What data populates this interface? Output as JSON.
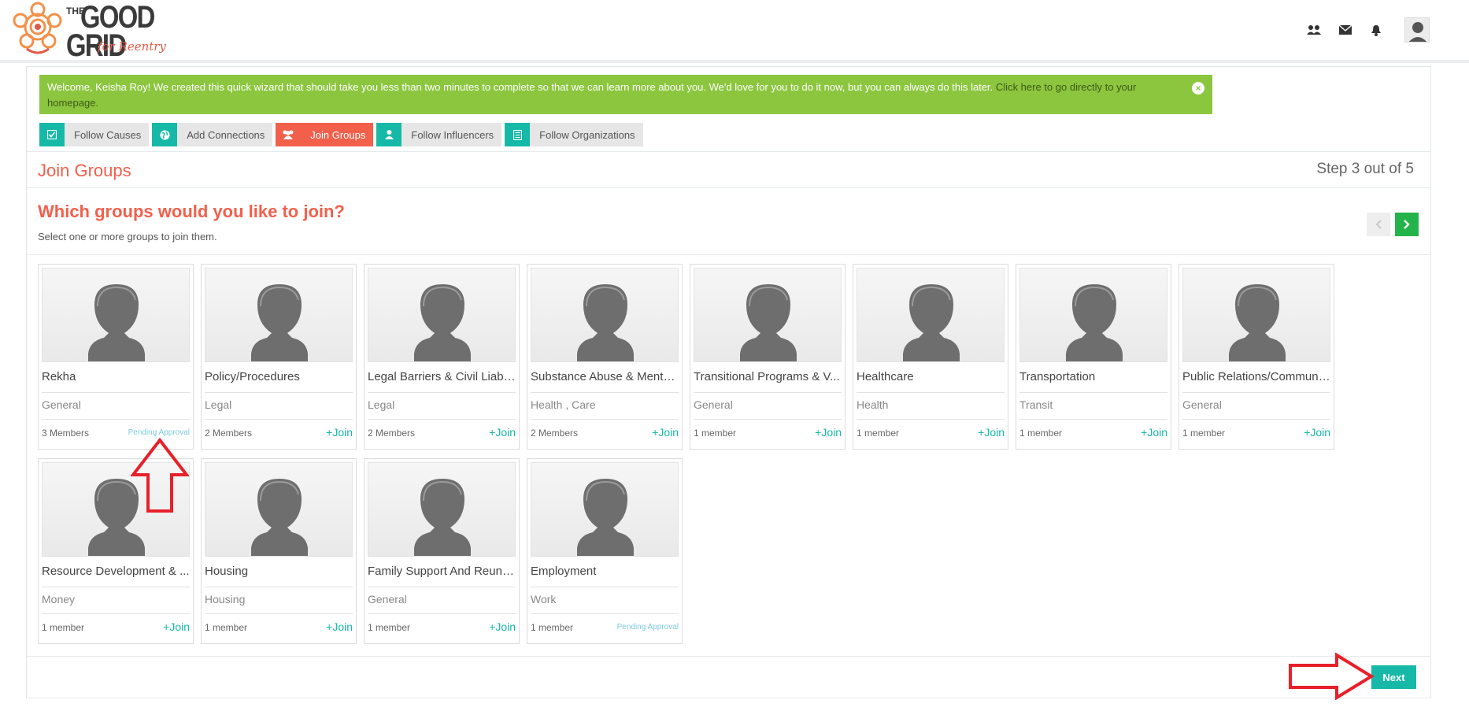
{
  "header": {
    "logo": {
      "the": "THE",
      "good": "GOOD",
      "grid": "GRID",
      "tagline": "for Reentry"
    },
    "icons": [
      "groups-icon",
      "envelope-icon",
      "bell-icon",
      "user-avatar"
    ]
  },
  "welcome": {
    "text": "Welcome, Keisha Roy! We created this quick wizard that should take you less than two minutes to complete so that we can learn more about you. We'd love for you to do it now, but you can always do this later. ",
    "link": "Click here to go directly to your homepage.",
    "close": "×"
  },
  "steps": [
    {
      "label": "Follow Causes",
      "icon": "checkbox-icon",
      "active": false
    },
    {
      "label": "Add Connections",
      "icon": "globe-icon",
      "active": false
    },
    {
      "label": "Join Groups",
      "icon": "groups-icon",
      "active": true
    },
    {
      "label": "Follow Influencers",
      "icon": "user-icon",
      "active": false
    },
    {
      "label": "Follow Organizations",
      "icon": "building-icon",
      "active": false
    }
  ],
  "page": {
    "title": "Join Groups",
    "step_count": "Step 3 out of 5",
    "question": "Which groups would you like to join?",
    "subtitle": "Select one or more groups to join them."
  },
  "groups": [
    {
      "name": "Rekha",
      "category": "General",
      "members": "3 Members",
      "action": "Pending Approval",
      "pending": true
    },
    {
      "name": "Policy/Procedures",
      "category": "Legal",
      "members": "2 Members",
      "action": "+Join",
      "pending": false
    },
    {
      "name": "Legal Barriers & Civil Liabil...",
      "category": "Legal",
      "members": "2 Members",
      "action": "+Join",
      "pending": false
    },
    {
      "name": "Substance Abuse & Mental...",
      "category": "Health , Care",
      "members": "2 Members",
      "action": "+Join",
      "pending": false
    },
    {
      "name": "Transitional Programs & V...",
      "category": "General",
      "members": "1 member",
      "action": "+Join",
      "pending": false
    },
    {
      "name": "Healthcare",
      "category": "Health",
      "members": "1 member",
      "action": "+Join",
      "pending": false
    },
    {
      "name": "Transportation",
      "category": "Transit",
      "members": "1 member",
      "action": "+Join",
      "pending": false
    },
    {
      "name": "Public Relations/Communi...",
      "category": "General",
      "members": "1 member",
      "action": "+Join",
      "pending": false
    },
    {
      "name": "Resource Development & ...",
      "category": "Money",
      "members": "1 member",
      "action": "+Join",
      "pending": false
    },
    {
      "name": "Housing",
      "category": "Housing",
      "members": "1 member",
      "action": "+Join",
      "pending": false
    },
    {
      "name": "Family Support And Reunifi...",
      "category": "General",
      "members": "1 member",
      "action": "+Join",
      "pending": false
    },
    {
      "name": "Employment",
      "category": "Work",
      "members": "1 member",
      "action": "Pending Approval",
      "pending": true
    }
  ],
  "footer": {
    "next_label": "Next"
  },
  "colors": {
    "accent": "#16b9a8",
    "title": "#f2604c",
    "welcome_bg": "#8cc63f",
    "annotation": "#e8202a"
  }
}
